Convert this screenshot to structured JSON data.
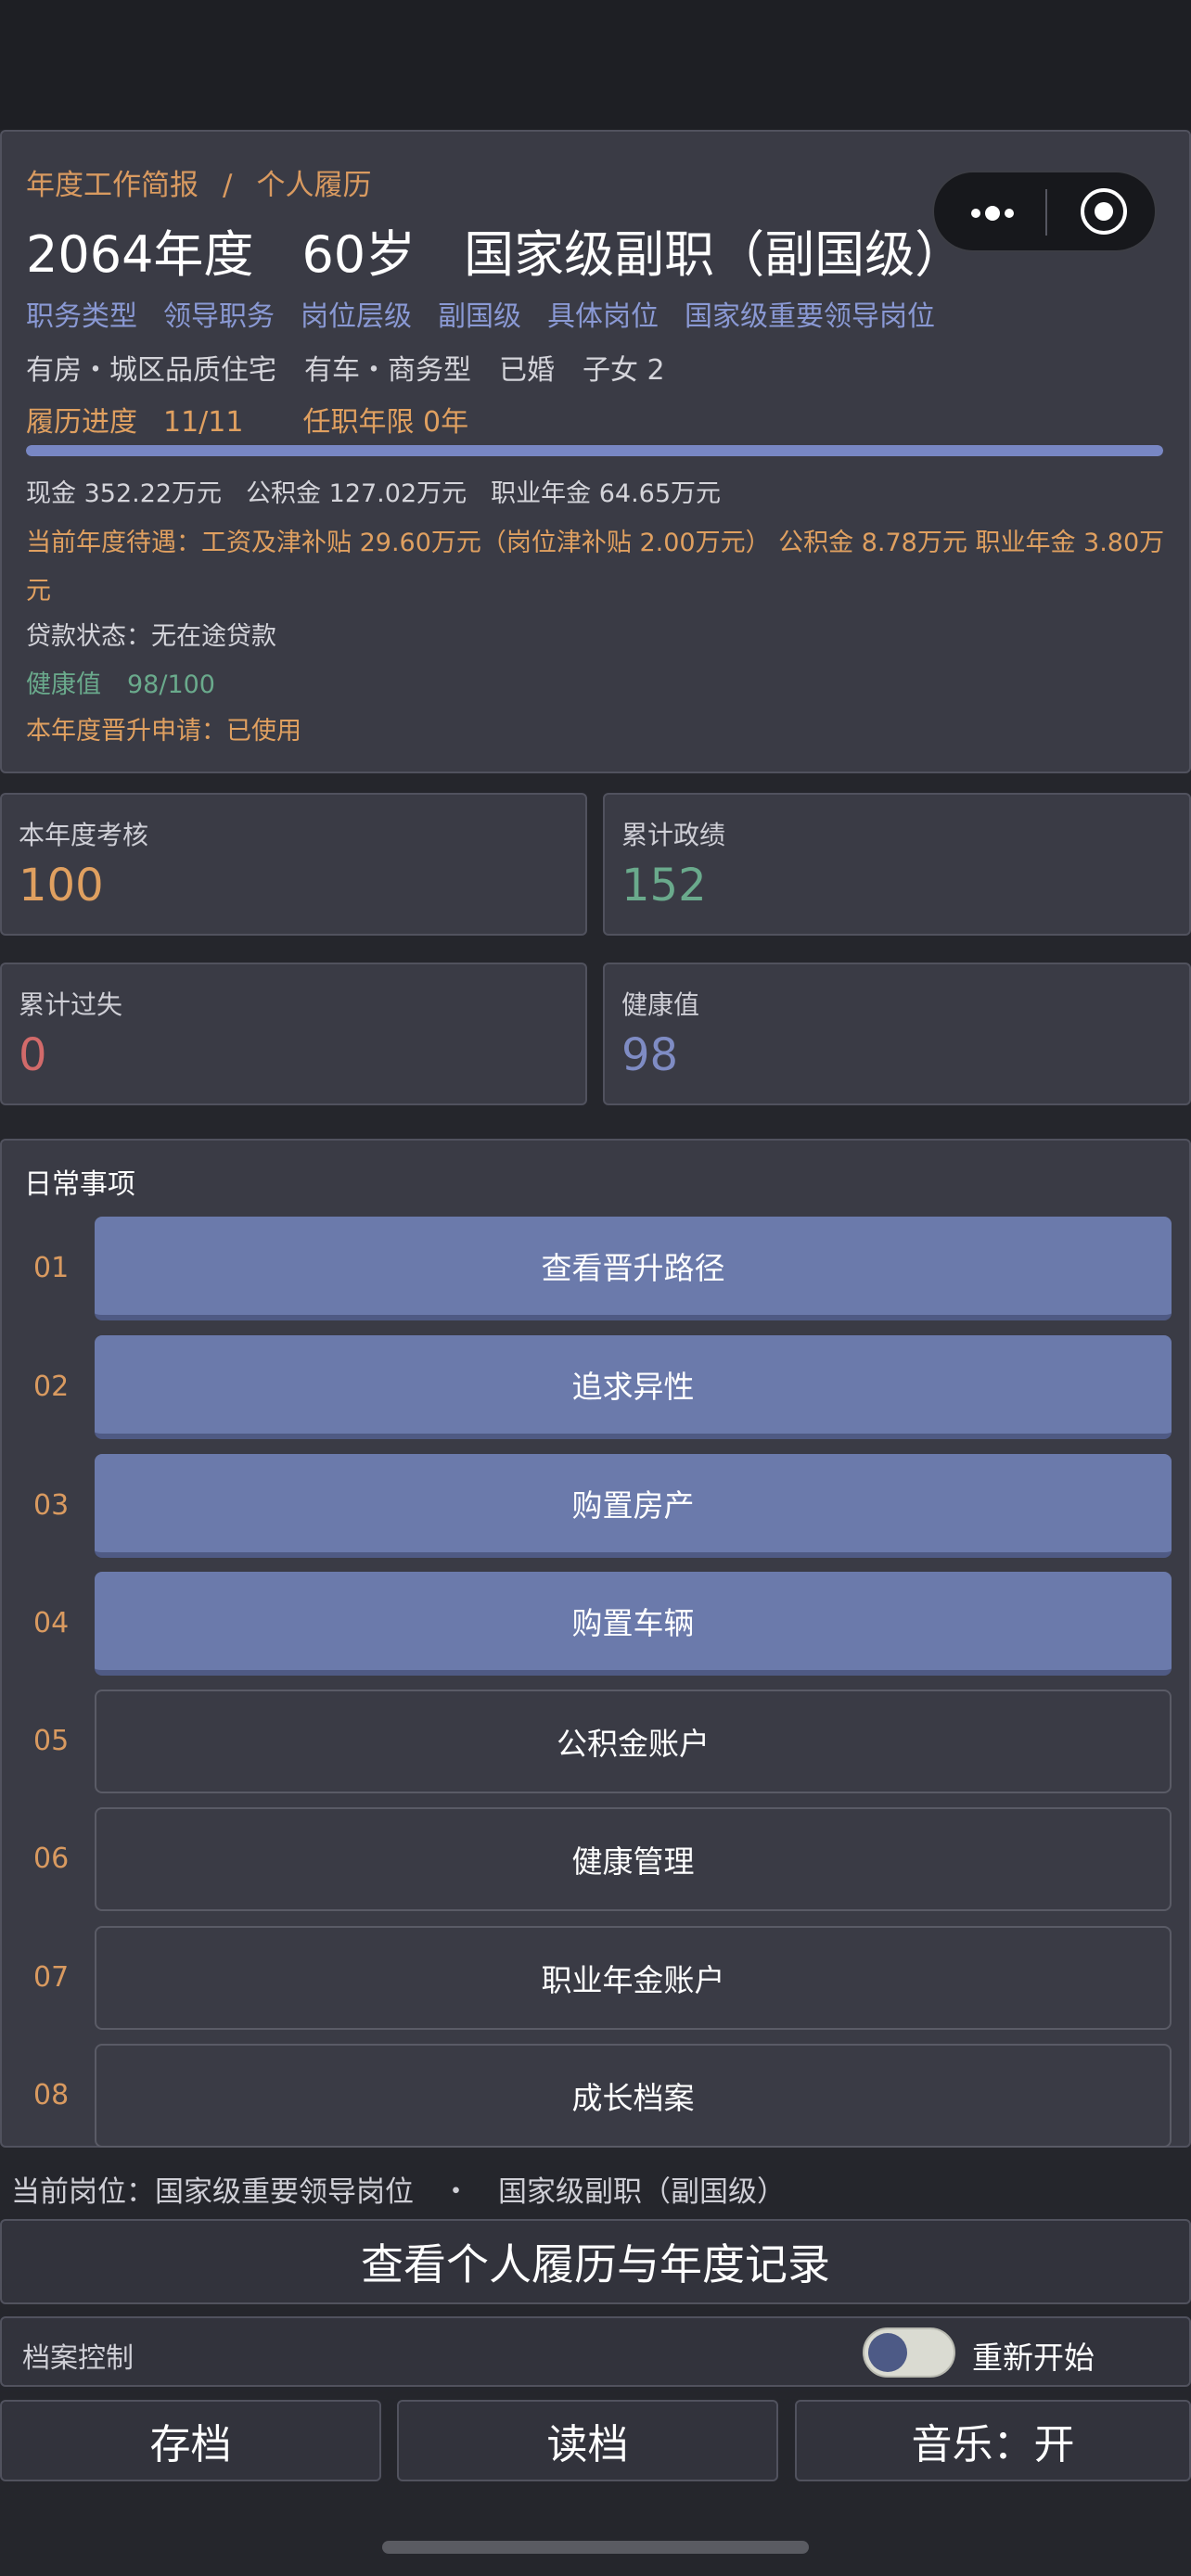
{
  "breadcrumb": {
    "item1": "年度工作简报",
    "sep": "/",
    "item2": "个人履历"
  },
  "headline": {
    "year": "2064年度",
    "age": "60岁",
    "rank": "国家级副职（副国级）"
  },
  "tags": [
    "职务类型",
    "领导职务",
    "岗位层级",
    "副国级",
    "具体岗位",
    "国家级重要领导岗位"
  ],
  "assets": [
    "有房・城区品质住宅",
    "有车・商务型",
    "已婚",
    "子女 2"
  ],
  "progress": {
    "label": "履历进度",
    "value": "11/11",
    "tenure": "任职年限 0年",
    "fraction": 1.0
  },
  "money": [
    "现金 352.22万元",
    "公积金 127.02万元",
    "职业年金 64.65万元"
  ],
  "salary_text": "当前年度待遇：工资及津补贴 29.60万元（岗位津补贴 2.00万元）  公积金 8.78万元  职业年金 3.80万元",
  "loan_text": "贷款状态：无在途贷款",
  "health": {
    "label": "健康值",
    "value": "98/100"
  },
  "promotion_text": "本年度晋升申请：已使用",
  "stats": [
    {
      "label": "本年度考核",
      "value": "100",
      "color": "#e0a060"
    },
    {
      "label": "累计政绩",
      "value": "152",
      "color": "#6aaa8c"
    },
    {
      "label": "累计过失",
      "value": "0",
      "color": "#d26a6a"
    },
    {
      "label": "健康值",
      "value": "98",
      "color": "#7f8cc4"
    }
  ],
  "daily": {
    "title": "日常事项",
    "items": [
      {
        "num": "01",
        "label": "查看晋升路径"
      },
      {
        "num": "02",
        "label": "追求异性"
      },
      {
        "num": "03",
        "label": "购置房产"
      },
      {
        "num": "04",
        "label": "购置车辆"
      },
      {
        "num": "05",
        "label": "公积金账户"
      },
      {
        "num": "06",
        "label": "健康管理"
      },
      {
        "num": "07",
        "label": "职业年金账户"
      },
      {
        "num": "08",
        "label": "成长档案"
      }
    ]
  },
  "current_position": {
    "post": "当前岗位：国家级重要领导岗位",
    "dot": "・",
    "rank": "国家级副职（副国级）"
  },
  "record_button": "查看个人履历与年度记录",
  "archive": {
    "label": "档案控制",
    "restart": "重新开始"
  },
  "bottom": {
    "save": "存档",
    "load": "读档",
    "music": "音乐：开"
  }
}
